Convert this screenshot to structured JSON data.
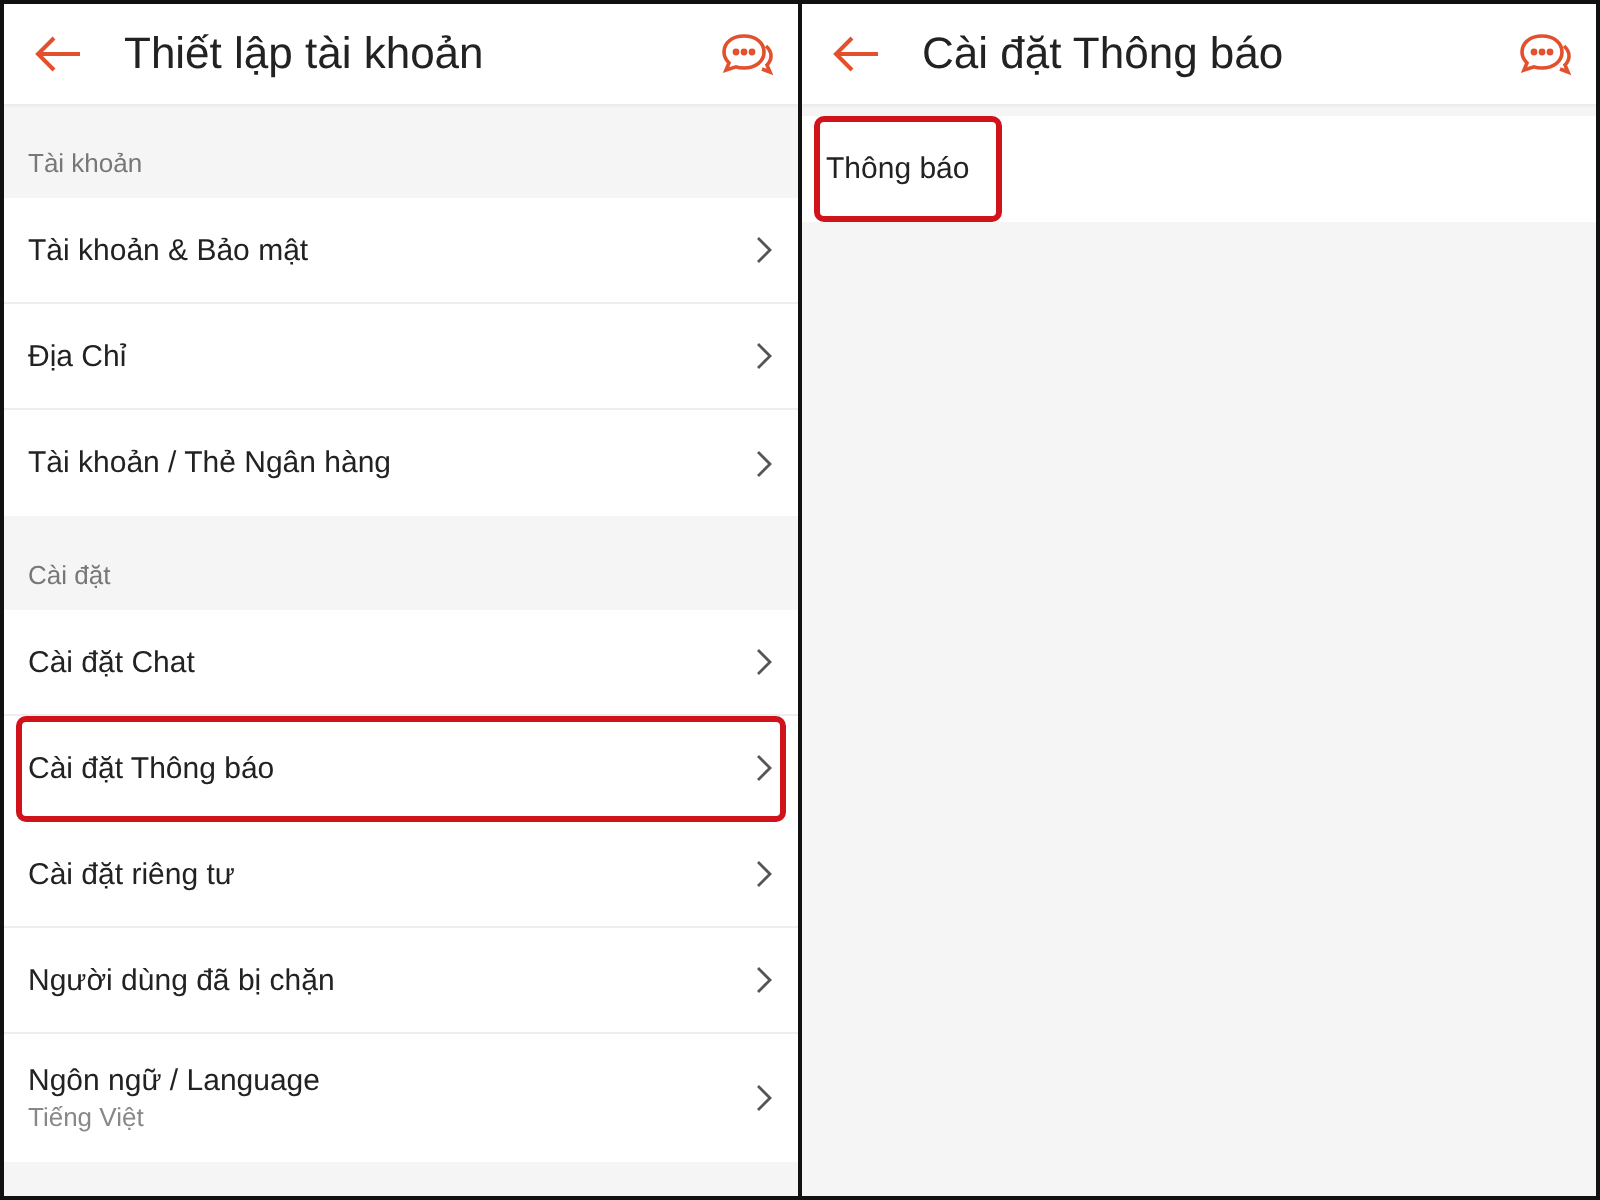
{
  "panes": [
    {
      "header": {
        "title": "Thiết lập tài khoản"
      },
      "sections": [
        {
          "label": "Tài khoản",
          "items": [
            {
              "label": "Tài khoản & Bảo mật",
              "highlighted": false
            },
            {
              "label": "Địa Chỉ",
              "highlighted": false
            },
            {
              "label": "Tài khoản / Thẻ Ngân hàng",
              "highlighted": false
            }
          ]
        },
        {
          "label": "Cài đặt",
          "items": [
            {
              "label": "Cài đặt Chat",
              "highlighted": false
            },
            {
              "label": "Cài đặt Thông báo",
              "highlighted": true
            },
            {
              "label": "Cài đặt riêng tư",
              "highlighted": false
            },
            {
              "label": "Người dùng đã bị chặn",
              "highlighted": false
            },
            {
              "label": "Ngôn ngữ / Language",
              "sublabel": "Tiếng Việt",
              "highlighted": false
            }
          ]
        }
      ]
    },
    {
      "header": {
        "title": "Cài đặt Thông báo"
      },
      "sections": [
        {
          "items": [
            {
              "label": "Thông báo",
              "highlighted": true,
              "chevron": false
            }
          ]
        }
      ]
    }
  ]
}
